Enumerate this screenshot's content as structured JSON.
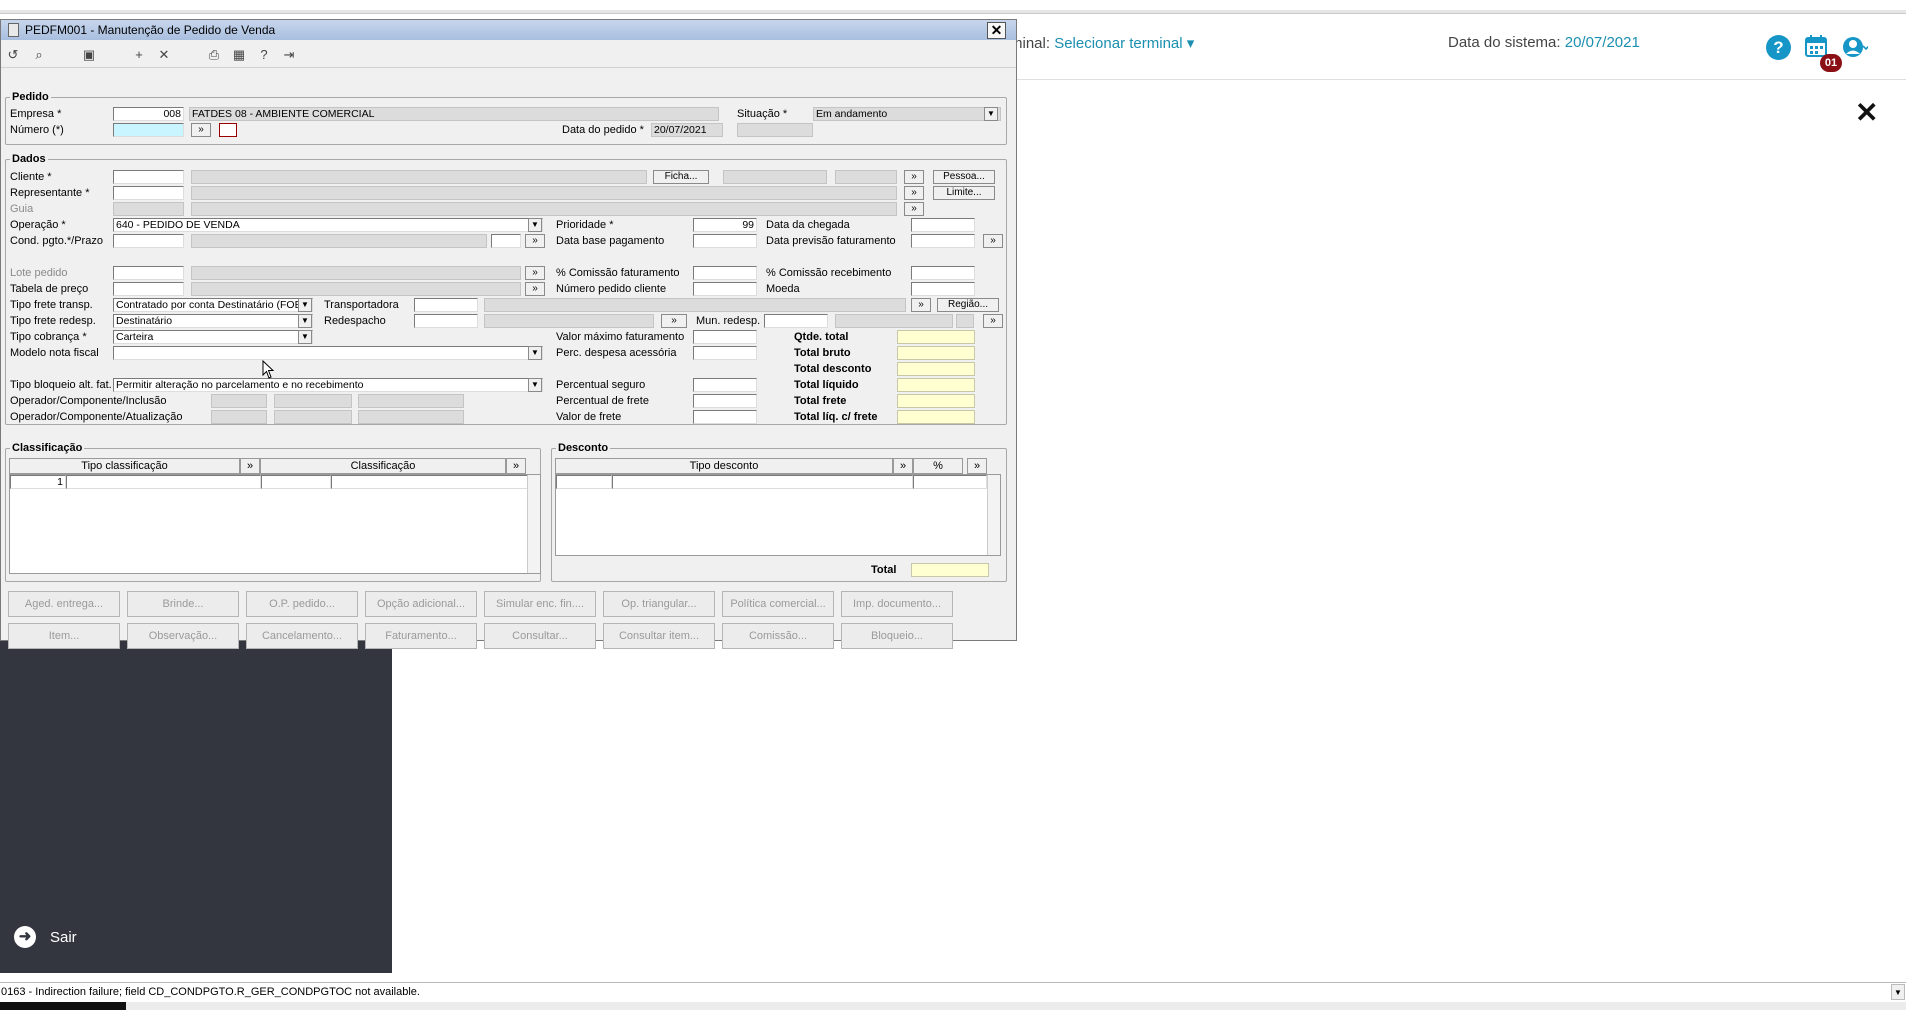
{
  "app": {
    "terminal_label": "rminal:",
    "terminal_value": "Selecionar terminal",
    "data_sistema_label": "Data do sistema:",
    "data_sistema_value": "20/07/2021",
    "notification_count": "01",
    "close_symbol": "✕",
    "accent_color": "#1a8fb0",
    "badge_color": "#8b1016"
  },
  "sidebar": {
    "sair_label": "Sair",
    "background": "#34363f"
  },
  "statusbar": {
    "message": "0163 - Indirection failure; field CD_CONDPGTO.R_GER_CONDPGTOC not available."
  },
  "window": {
    "title": "PEDFM001 - Manutenção de Pedido de Venda",
    "close_symbol": "✕",
    "toolbar_icons": [
      "undo-icon",
      "search-icon",
      "save-icon",
      "add-icon",
      "delete-icon",
      "print-icon",
      "calendar-icon",
      "help-icon",
      "exit-icon"
    ]
  },
  "pedido": {
    "legend": "Pedido",
    "empresa_label": "Empresa *",
    "empresa_code": "008",
    "empresa_name": "FATDES 08 - AMBIENTE COMERCIAL",
    "numero_label": "Número (*)",
    "numero_value": "",
    "numero_btn": "»",
    "situacao_label": "Situação *",
    "situacao_value": "Em andamento",
    "data_pedido_label": "Data do pedido *",
    "data_pedido_value": "20/07/2021"
  },
  "dados": {
    "legend": "Dados",
    "cliente_label": "Cliente *",
    "ficha_btn": "Ficha...",
    "pessoa_btn": "Pessoa...",
    "representante_label": "Representante *",
    "limite_btn": "Limite...",
    "guia_label": "Guia",
    "operacao_label": "Operação *",
    "operacao_value": "640 - PEDIDO DE VENDA",
    "prioridade_label": "Prioridade *",
    "prioridade_value": "99",
    "data_chegada_label": "Data da chegada",
    "cond_pgto_label": "Cond. pgto.*/Prazo",
    "data_base_label": "Data base pagamento",
    "data_prev_label": "Data previsão faturamento",
    "lote_label": "Lote pedido",
    "comissao_fat_label": "% Comissão faturamento",
    "comissao_rec_label": "% Comissão recebimento",
    "tabela_preco_label": "Tabela de preço",
    "num_pedido_cliente_label": "Número pedido cliente",
    "moeda_label": "Moeda",
    "tipo_frete_label": "Tipo frete transp.",
    "tipo_frete_value": "Contratado por conta Destinatário (FOB)",
    "transportadora_label": "Transportadora",
    "regiao_btn": "Região...",
    "tipo_frete_redesp_label": "Tipo frete redesp.",
    "tipo_frete_redesp_value": "Destinatário",
    "redespacho_label": "Redespacho",
    "mun_redesp_label": "Mun. redesp.",
    "tipo_cobranca_label": "Tipo cobrança *",
    "tipo_cobranca_value": "Carteira",
    "valor_max_label": "Valor máximo faturamento",
    "qtde_total_label": "Qtde. total",
    "modelo_nf_label": "Modelo nota fiscal",
    "perc_despesa_label": "Perc. despesa acessória",
    "total_bruto_label": "Total bruto",
    "total_desconto_label": "Total desconto",
    "tipo_bloqueio_label": "Tipo bloqueio alt. fat.",
    "tipo_bloqueio_value": "Permitir alteração no parcelamento e no recebimento",
    "perc_seguro_label": "Percentual seguro",
    "total_liquido_label": "Total líquido",
    "operador_inc_label": "Operador/Componente/Inclusão",
    "perc_frete_label": "Percentual de frete",
    "total_frete_label": "Total frete",
    "operador_atu_label": "Operador/Componente/Atualização",
    "valor_frete_label": "Valor de frete",
    "total_liq_frete_label": "Total líq. c/ frete"
  },
  "classificacao": {
    "legend": "Classificação",
    "col_tipo": "Tipo classificação",
    "col_class": "Classificação",
    "more_btn": "»",
    "row_number": "1"
  },
  "desconto": {
    "legend": "Desconto",
    "col_tipo": "Tipo desconto",
    "col_pct": "%",
    "more_btn": "»",
    "total_label": "Total"
  },
  "buttons_row1": [
    "Aged. entrega...",
    "Brinde...",
    "O.P. pedido...",
    "Opção adicional...",
    "Simular enc. fin....",
    "Op. triangular...",
    "Política comercial...",
    "Imp. documento..."
  ],
  "buttons_row2": [
    "Item...",
    "Observação...",
    "Cancelamento...",
    "Faturamento...",
    "Consultar...",
    "Consultar item...",
    "Comissão...",
    "Bloqueio..."
  ]
}
